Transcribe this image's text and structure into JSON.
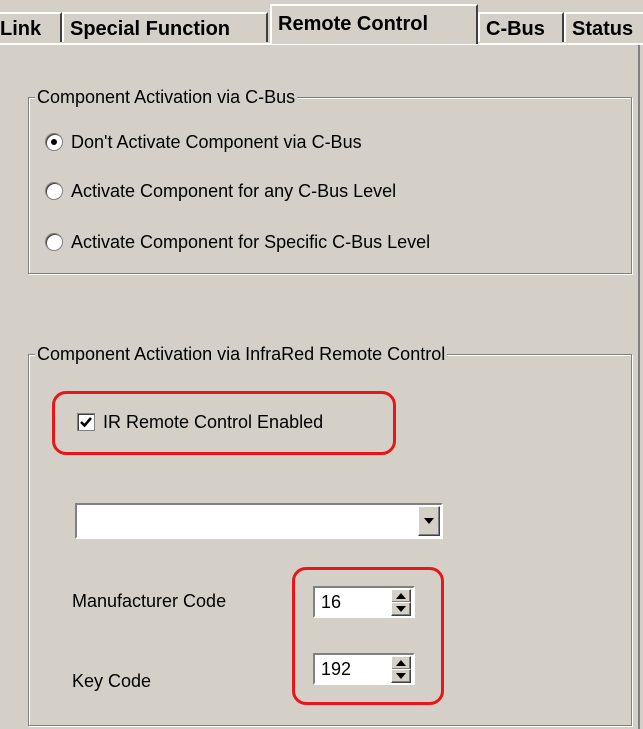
{
  "tabs": [
    {
      "label": "Link",
      "active": false
    },
    {
      "label": "Special Function",
      "active": false
    },
    {
      "label": "Remote Control",
      "active": true
    },
    {
      "label": "C-Bus",
      "active": false
    },
    {
      "label": "Status",
      "active": false
    }
  ],
  "cbus_group": {
    "legend": "Component Activation via C-Bus",
    "options": [
      {
        "label": "Don't Activate Component via C-Bus",
        "selected": true
      },
      {
        "label": "Activate Component for any C-Bus Level",
        "selected": false
      },
      {
        "label": "Activate Component for Specific C-Bus Level",
        "selected": false
      }
    ]
  },
  "ir_group": {
    "legend": "Component Activation via InfraRed Remote Control",
    "ir_enabled": {
      "label": "IR Remote Control Enabled",
      "checked": true
    },
    "combo": {
      "value": ""
    },
    "manufacturer_code": {
      "label": "Manufacturer Code",
      "value": "16"
    },
    "key_code": {
      "label": "Key Code",
      "value": "192"
    }
  },
  "colors": {
    "highlight": "#e8151b",
    "face": "#d4d0c8"
  }
}
